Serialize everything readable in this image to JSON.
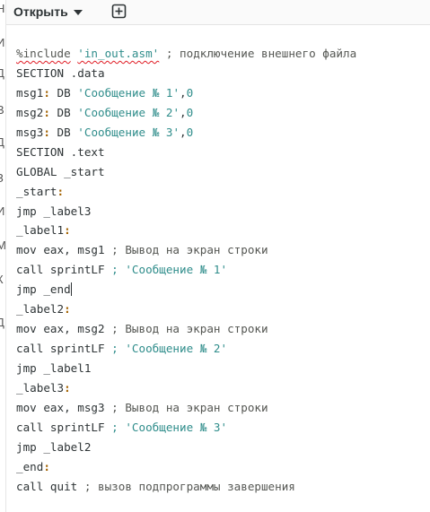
{
  "header": {
    "open_label": "Открыть"
  },
  "left_strip": {
    "letters": [
      "Н",
      "И",
      "Д",
      "В",
      "Д",
      "З",
      "И",
      "М",
      "К",
      "Д"
    ]
  },
  "code": {
    "include_directive": "%include",
    "include_file": "'in_out.asm'",
    "include_comment": "; подключение внешнего файла",
    "section_data": "SECTION .data",
    "msg1_name": "msg1",
    "msg1_db": "DB",
    "msg1_str": "'Сообщение № 1'",
    "msg1_zero": "0",
    "msg2_name": "msg2",
    "msg2_db": "DB",
    "msg2_str": "'Сообщение № 2'",
    "msg2_zero": "0",
    "msg3_name": "msg3",
    "msg3_db": "DB",
    "msg3_str": "'Сообщение № 3'",
    "msg3_zero": "0",
    "section_text": "SECTION .text",
    "global": "GLOBAL _start",
    "start_label": "_start",
    "jmp_label3": "jmp _label3",
    "label1": "_label1",
    "mov_msg1": "mov eax, msg1",
    "mov_msg1_comment": "; Вывод на экран строки",
    "call_sprint_1": "call sprintLF",
    "call_sprint_1_comment": "; 'Сообщение № 1'",
    "jmp_end_a": "jmp _end",
    "label2": "_label2",
    "mov_msg2": "mov eax, msg2",
    "mov_msg2_comment": "; Вывод на экран строки",
    "call_sprint_2": "call sprintLF",
    "call_sprint_2_comment": "; 'Сообщение № 2'",
    "jmp_label1": "jmp _label1",
    "label3": "_label3",
    "mov_msg3": "mov eax, msg3",
    "mov_msg3_comment": "; Вывод на экран строки",
    "call_sprint_3": "call sprintLF",
    "call_sprint_3_comment": "; 'Сообщение № 3'",
    "jmp_label2": "jmp _label2",
    "end_label": "_end",
    "call_quit": "call quit",
    "call_quit_comment": "; вызов подпрограммы завершения"
  }
}
